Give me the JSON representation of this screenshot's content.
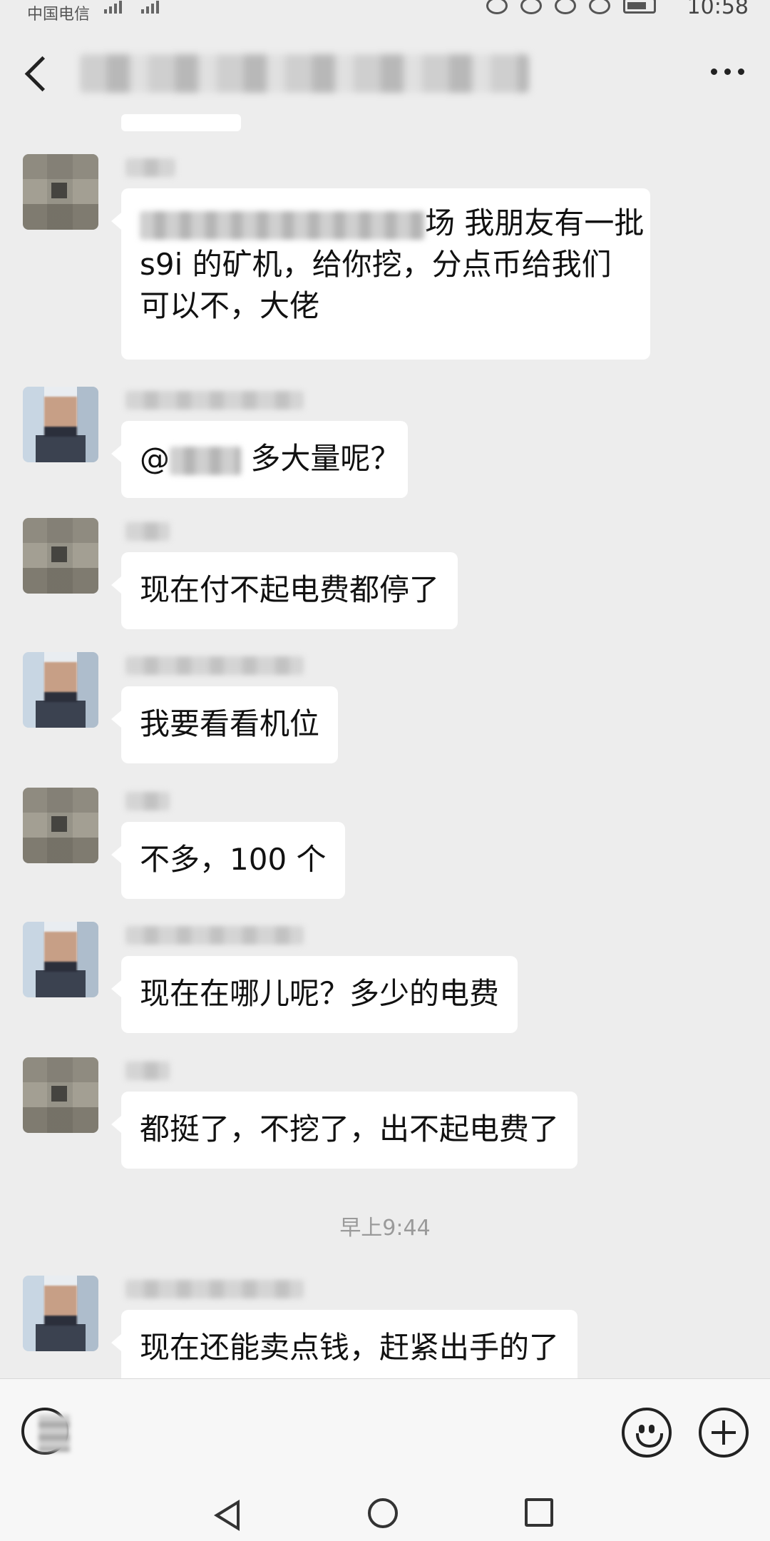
{
  "status_bar": {
    "carrier": "中国电信",
    "time": "10:58"
  },
  "header": {
    "title": "",
    "more_label": "..."
  },
  "messages": [
    {
      "text_suffix": "场  我朋友有一批",
      "line2": "s9i 的矿机，给你挖，分点币给我们",
      "line3": "可以不，大佬"
    },
    {
      "text_prefix": "@",
      "text_suffix": " 多大量呢？"
    },
    {
      "text": "现在付不起电费都停了"
    },
    {
      "text": "我要看看机位"
    },
    {
      "text": "不多，100 个"
    },
    {
      "text": "现在在哪儿呢？多少的电费"
    },
    {
      "text": "都挺了，不挖了，出不起电费了"
    },
    {
      "text": "现在还能卖点钱，赶紧出手的了"
    }
  ],
  "time_divider": "早上9:44",
  "icons": {
    "back": "chevron-left-icon",
    "more": "more-dots-icon",
    "voice": "voice-icon",
    "emoji": "emoji-icon",
    "plus": "plus-icon",
    "nav_back": "nav-back-icon",
    "nav_home": "nav-home-icon",
    "nav_recent": "nav-recent-icon"
  }
}
